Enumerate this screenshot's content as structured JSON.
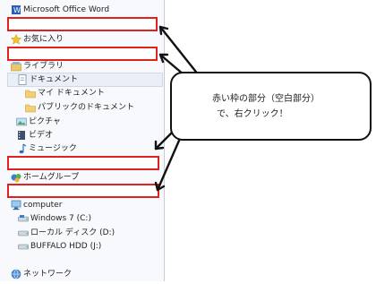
{
  "nav": {
    "word": "Microsoft Office Word",
    "favorites": "お気に入り",
    "library": "ライブラリ",
    "documents": "ドキュメント",
    "my_documents": "マイ ドキュメント",
    "public_documents": "パブリックのドキュメント",
    "pictures": "ピクチャ",
    "video": "ビデオ",
    "music": "ミュージック",
    "homegroup": "ホームグループ",
    "computer": "computer",
    "drive_c": "Windows 7 (C:)",
    "drive_d": "ローカル ディスク (D:)",
    "drive_j": "BUFFALO HDD (J:)",
    "network": "ネットワーク"
  },
  "callout": {
    "line1": "赤い枠の部分（空白部分）",
    "line2": "で、右クリック！"
  },
  "colors": {
    "highlight": "#e0221e",
    "pane_bg": "#f7f9fc"
  }
}
